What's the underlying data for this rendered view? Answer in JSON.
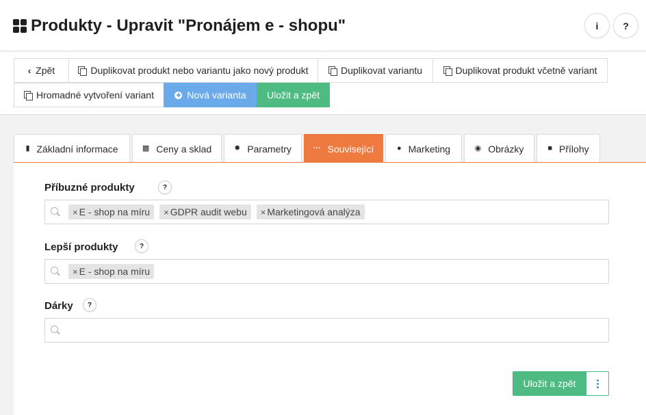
{
  "header": {
    "title": "Produkty - Upravit \"Pronájem e - shopu\"",
    "info_label": "i",
    "help_label": "?"
  },
  "toolbar": {
    "back": "Zpět",
    "duplicate_product": "Duplikovat produkt nebo variantu jako nový produkt",
    "duplicate_variant": "Duplikovat variantu",
    "duplicate_with_variants": "Duplikovat produkt včetně variant",
    "bulk_variants": "Hromadné vytvoření variant",
    "new_variant": "Nová varianta",
    "save_back": "Uložit a zpět"
  },
  "tabs": [
    {
      "label": "Základní informace",
      "icon": "book-icon"
    },
    {
      "label": "Ceny a sklad",
      "icon": "money-icon"
    },
    {
      "label": "Parametry",
      "icon": "gear-icon"
    },
    {
      "label": "Související",
      "icon": "dots-icon",
      "active": true
    },
    {
      "label": "Marketing",
      "icon": "globe-icon"
    },
    {
      "label": "Obrázky",
      "icon": "camera-icon"
    },
    {
      "label": "Přílohy",
      "icon": "archive-icon"
    }
  ],
  "fields": {
    "related": {
      "label": "Příbuzné produkty",
      "help": "?",
      "tags": [
        "E - shop na míru",
        "GDPR audit webu",
        "Marketingová analýza"
      ]
    },
    "better": {
      "label": "Lepší produkty",
      "help": "?",
      "tags": [
        "E - shop na míru"
      ]
    },
    "gifts": {
      "label": "Dárky",
      "help": "?",
      "tags": []
    }
  },
  "footer": {
    "save_back": "Uložit a zpět"
  },
  "colors": {
    "active_tab": "#ef7a3f",
    "blue_button": "#6aa9ea",
    "green_button": "#4dbb82"
  }
}
